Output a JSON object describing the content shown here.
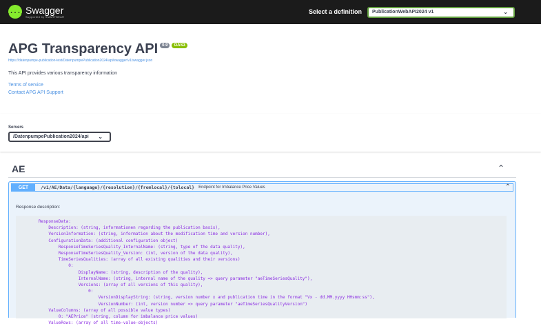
{
  "topbar": {
    "logo_text": "Swagger",
    "logo_subtext": "Supported by SMARTBEAR",
    "logo_symbol": "{...}",
    "definition_label": "Select a definition",
    "definition_value": "PublicationWebAPI2024 v1"
  },
  "info": {
    "title": "APG Transparency API",
    "version_badge": "0.9",
    "oas_badge": "OAS3",
    "spec_url": "https://datenpumpe-publication-test/DatenpumpePublication2024/api/swagger/v1/swagger.json",
    "description": "This API provides various transparency information",
    "terms_link": "Terms of service",
    "contact_link": "Contact APG API Support"
  },
  "servers": {
    "label": "Servers",
    "selected": "/DatenpumpePublication2024/api"
  },
  "tag": {
    "name": "AE"
  },
  "operation": {
    "method": "GET",
    "path": "/v1/AE/Data/{language}/{resolution}/{fromlocal}/{tolocal}",
    "summary": "Endpoint for Imbalance Price Values",
    "response_label": "Response description:",
    "code_lines": [
      "ResponseData:",
      "    Description: (string, informationen regarding the publication basis),",
      "    VersionInformation: (string, information about the modification time and version number),",
      "    ConfigurationData: (additional configuration object)",
      "        ResponseTimeSeriesQuality_InternalName: (string, type of the data quality),",
      "        ResponseTimeSeriesQuality_Version: (int, version of the data quality),",
      "        TimeSeriesQualities: (array of all existing qualities and their versions)",
      "            0:",
      "                DisplayName: (string, description of the quality),",
      "                InternalName: (string, internal name of the quality => query parameter \"aeTimeSeriesQuality\"),",
      "                Versions: (array of all versions of this quality),",
      "                    0:",
      "                        VersionDisplayString: (string, version number x and publication time in the format \"Vx - dd.MM.yyyy HHsmm:ss\"),",
      "                        VersionNumber: (int, version number => query parameter \"aeTimeSeriesQualityVersion\")",
      "    ValueColumns: (array of all possible value types)",
      "        0: \"AEPrice\" (string, column for imbalance price values)",
      "    ValueRows: (array of all time-value-objects)"
    ]
  },
  "colors": {
    "topbar": "#1b1b1b",
    "accent_green": "#85ea2d",
    "get_blue": "#61affe",
    "code_purple": "#8a2be2"
  }
}
